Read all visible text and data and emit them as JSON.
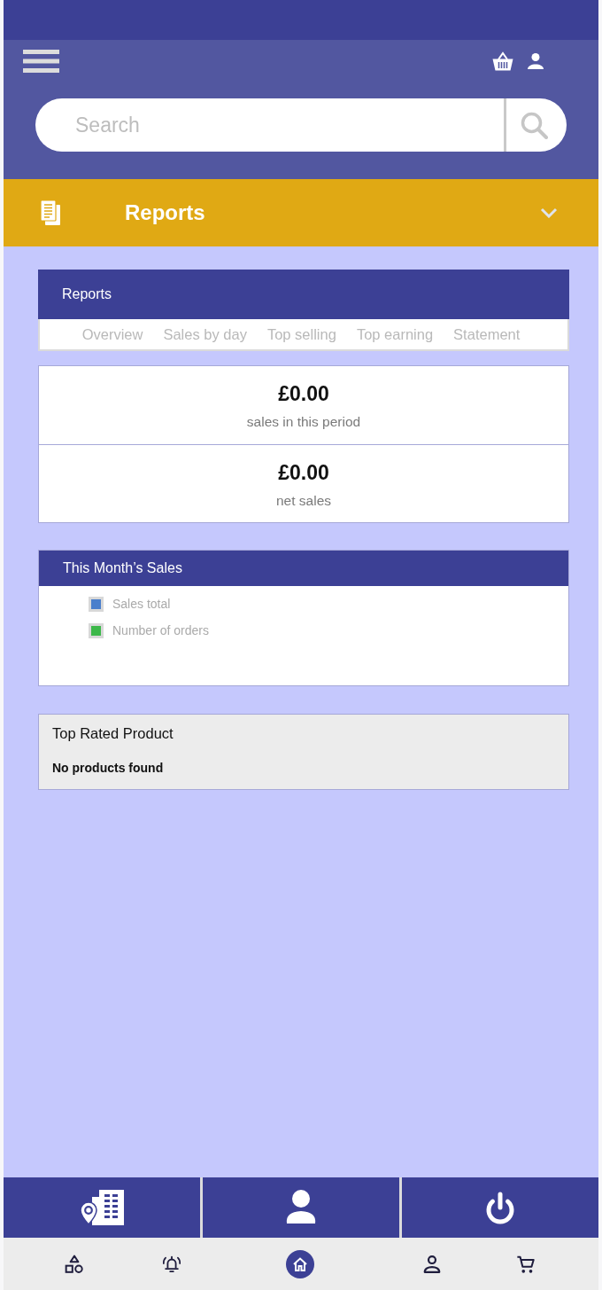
{
  "search": {
    "placeholder": "Search"
  },
  "section_bar": {
    "title": "Reports",
    "expanded": false
  },
  "reports_card": {
    "title": "Reports",
    "tabs": [
      {
        "label": "Overview",
        "selected": false
      },
      {
        "label": "Sales by day",
        "selected": false
      },
      {
        "label": "Top selling",
        "selected": false
      },
      {
        "label": "Top earning",
        "selected": false
      },
      {
        "label": "Statement",
        "selected": false
      }
    ]
  },
  "stats": [
    {
      "value": "£0.00",
      "label": "sales in this period"
    },
    {
      "value": "£0.00",
      "label": "net sales"
    }
  ],
  "sales_chart": {
    "title": "This Month’s Sales",
    "legend": [
      {
        "label": "Sales total",
        "color": "#4a7fcc"
      },
      {
        "label": "Number of orders",
        "color": "#3db84a"
      }
    ]
  },
  "top_rated": {
    "title": "Top Rated Product",
    "message": "No products found"
  },
  "bottom_nav": [
    {
      "selected": false
    },
    {
      "selected": false
    },
    {
      "selected": true
    },
    {
      "selected": false
    },
    {
      "selected": false
    }
  ]
}
